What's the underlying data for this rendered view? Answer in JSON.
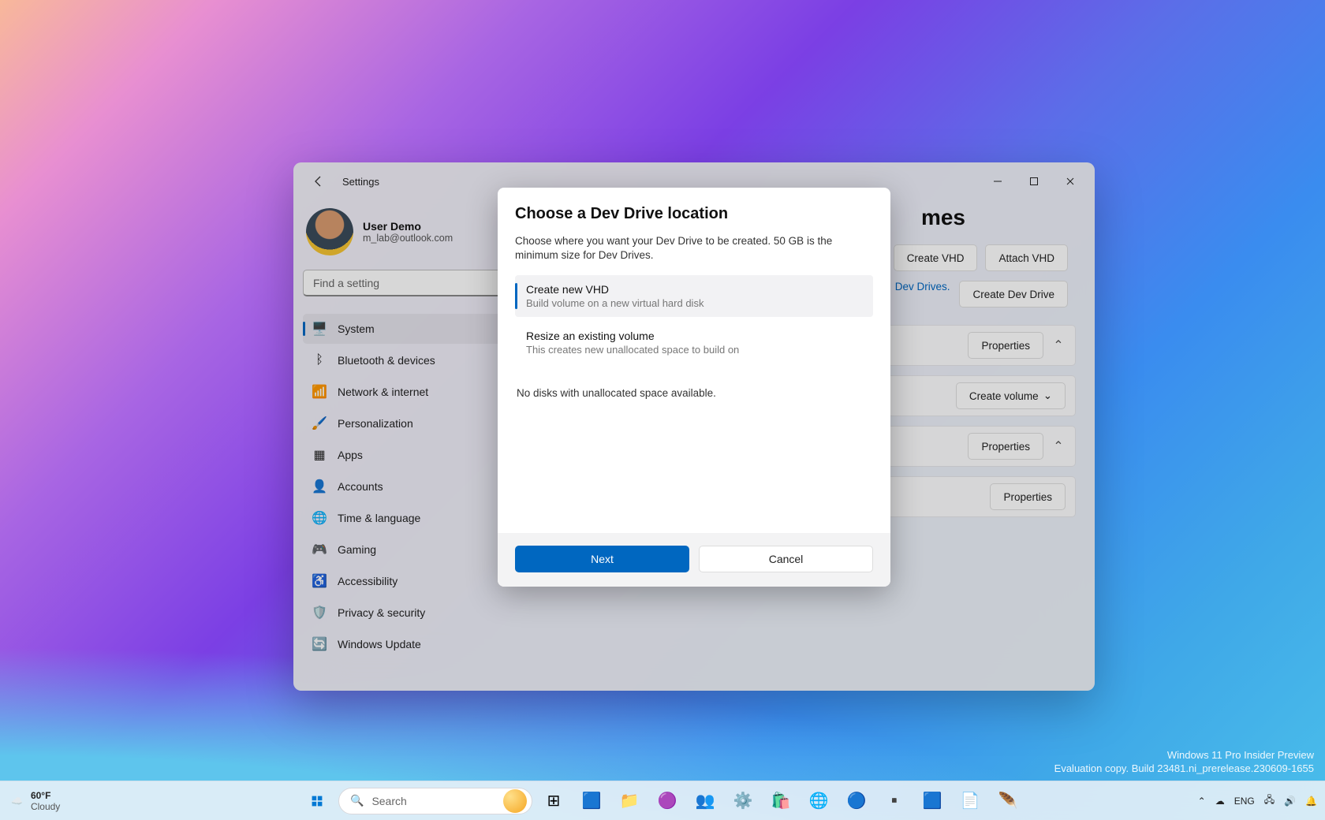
{
  "window": {
    "title": "Settings"
  },
  "account": {
    "name": "User Demo",
    "email": "m_lab@outlook.com"
  },
  "search": {
    "placeholder": "Find a setting"
  },
  "nav": [
    {
      "icon": "🖥️",
      "label": "System"
    },
    {
      "icon": "ᛒ",
      "label": "Bluetooth & devices"
    },
    {
      "icon": "📶",
      "label": "Network & internet"
    },
    {
      "icon": "🖌️",
      "label": "Personalization"
    },
    {
      "icon": "▦",
      "label": "Apps"
    },
    {
      "icon": "👤",
      "label": "Accounts"
    },
    {
      "icon": "🌐",
      "label": "Time & language"
    },
    {
      "icon": "🎮",
      "label": "Gaming"
    },
    {
      "icon": "♿",
      "label": "Accessibility"
    },
    {
      "icon": "🛡️",
      "label": "Privacy & security"
    },
    {
      "icon": "🔄",
      "label": "Windows Update"
    }
  ],
  "page": {
    "title_suffix": "mes",
    "btn_create_vhd": "Create VHD",
    "btn_attach_vhd": "Attach VHD",
    "link_dev": "Dev Drives.",
    "btn_create_dev": "Create Dev Drive",
    "btn_properties": "Properties",
    "btn_create_volume": "Create volume"
  },
  "modal": {
    "title": "Choose a Dev Drive location",
    "desc": "Choose where you want your Dev Drive to be created. 50 GB is the minimum size for Dev Drives.",
    "opt1_title": "Create new VHD",
    "opt1_sub": "Build volume on a new virtual hard disk",
    "opt2_title": "Resize an existing volume",
    "opt2_sub": "This creates new unallocated space to build on",
    "no_disk": "No disks with unallocated space available.",
    "next": "Next",
    "cancel": "Cancel"
  },
  "taskbar": {
    "temp": "60°F",
    "cond": "Cloudy",
    "search": "Search",
    "lang": "ENG",
    "time": "",
    "date": ""
  },
  "watermark": {
    "l1": "Windows 11 Pro Insider Preview",
    "l2": "Evaluation copy. Build 23481.ni_prerelease.230609-1655"
  }
}
